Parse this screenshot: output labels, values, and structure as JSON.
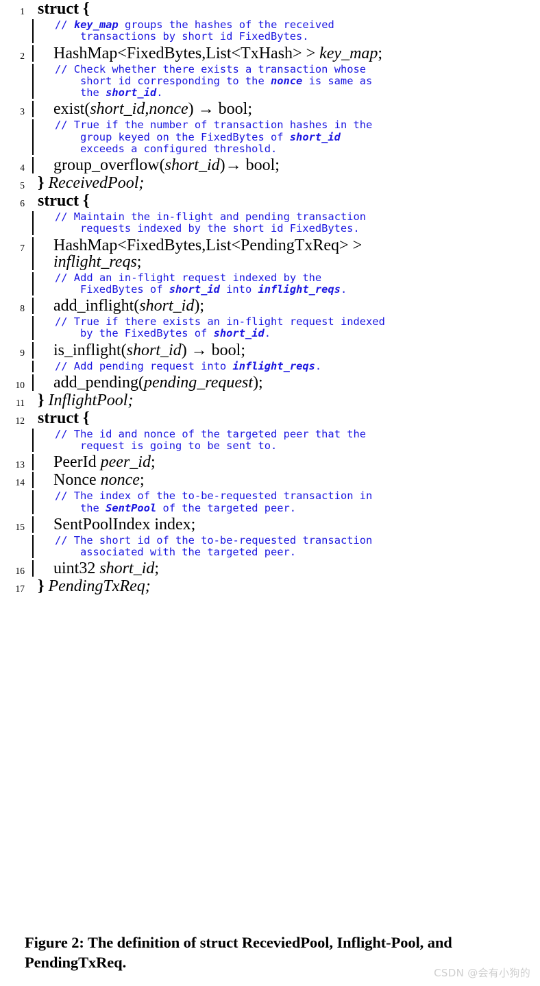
{
  "figure": {
    "caption": "Figure 2: The definition of struct ReceviedPool, Inflight-Pool, and PendingTxReq."
  },
  "watermark": {
    "text": "CSDN @会有小狗的"
  },
  "colors": {
    "comment_blue": "#1a16e0",
    "code_black": "#000000",
    "page_background": "#ffffff",
    "watermark_gray": "#cfcfcf"
  },
  "listing": {
    "lines": [
      {
        "number": "1",
        "kind": "struct-open",
        "text": "struct {"
      },
      {
        "number": "",
        "kind": "comment",
        "segments": [
          {
            "text": "// ",
            "style": "plain"
          },
          {
            "text": "key_map",
            "style": "italic"
          },
          {
            "text": " groups the hashes of the received",
            "style": "plain"
          }
        ],
        "continuation": [
          {
            "text": "transactions by short id FixedBytes.",
            "style": "plain"
          }
        ]
      },
      {
        "number": "2",
        "kind": "code",
        "segments": [
          {
            "text": "HashMap<FixedBytes,List<TxHash> > ",
            "style": "plain"
          },
          {
            "text": "key_map",
            "style": "italic"
          },
          {
            "text": ";",
            "style": "plain"
          }
        ]
      },
      {
        "number": "",
        "kind": "comment",
        "segments": [
          {
            "text": "// Check whether there exists a transaction whose",
            "style": "plain"
          }
        ],
        "continuation": [
          {
            "text": "short id corresponding to the ",
            "style": "plain"
          },
          {
            "text": "nonce",
            "style": "italic"
          },
          {
            "text": " is same as",
            "style": "plain"
          }
        ],
        "continuation2": [
          {
            "text": "the ",
            "style": "plain"
          },
          {
            "text": "short_id",
            "style": "italic"
          },
          {
            "text": ".",
            "style": "plain"
          }
        ]
      },
      {
        "number": "3",
        "kind": "code",
        "segments": [
          {
            "text": "exist(",
            "style": "plain"
          },
          {
            "text": "short_id,nonce",
            "style": "italic"
          },
          {
            "text": ") → bool;",
            "style": "plain"
          }
        ]
      },
      {
        "number": "",
        "kind": "comment",
        "segments": [
          {
            "text": "// True if the number of transaction hashes in the",
            "style": "plain"
          }
        ],
        "continuation": [
          {
            "text": "group keyed on the FixedBytes of ",
            "style": "plain"
          },
          {
            "text": "short_id",
            "style": "italic"
          }
        ],
        "continuation2": [
          {
            "text": "exceeds a configured threshold.",
            "style": "plain"
          }
        ]
      },
      {
        "number": "4",
        "kind": "code",
        "segments": [
          {
            "text": "group_overflow(",
            "style": "plain"
          },
          {
            "text": "short_id",
            "style": "italic"
          },
          {
            "text": ")→ bool;",
            "style": "plain"
          }
        ]
      },
      {
        "number": "5",
        "kind": "struct-close",
        "segments": [
          {
            "text": "}",
            "style": "bold"
          },
          {
            "text": " ReceivedPool;",
            "style": "italic"
          }
        ]
      },
      {
        "number": "6",
        "kind": "struct-open",
        "text": "struct {"
      },
      {
        "number": "",
        "kind": "comment",
        "segments": [
          {
            "text": "// Maintain the in-flight and pending transaction",
            "style": "plain"
          }
        ],
        "continuation": [
          {
            "text": "requests indexed by the short id FixedBytes.",
            "style": "plain"
          }
        ]
      },
      {
        "number": "7",
        "kind": "code-wrap",
        "segments": [
          {
            "text": "HashMap<FixedBytes,List<PendingTxReq> >",
            "style": "plain"
          }
        ],
        "wrapped": [
          {
            "text": "inflight_reqs",
            "style": "italic"
          },
          {
            "text": ";",
            "style": "plain"
          }
        ]
      },
      {
        "number": "",
        "kind": "comment",
        "segments": [
          {
            "text": "// Add an in-flight request indexed by the",
            "style": "plain"
          }
        ],
        "continuation": [
          {
            "text": "FixedBytes of ",
            "style": "plain"
          },
          {
            "text": "short_id",
            "style": "italic"
          },
          {
            "text": " into ",
            "style": "plain"
          },
          {
            "text": "inflight_reqs",
            "style": "italic"
          },
          {
            "text": ".",
            "style": "plain"
          }
        ]
      },
      {
        "number": "8",
        "kind": "code",
        "segments": [
          {
            "text": "add_inflight(",
            "style": "plain"
          },
          {
            "text": "short_id",
            "style": "italic"
          },
          {
            "text": ");",
            "style": "plain"
          }
        ]
      },
      {
        "number": "",
        "kind": "comment",
        "segments": [
          {
            "text": "// True if there exists an in-flight request indexed",
            "style": "plain"
          }
        ],
        "continuation": [
          {
            "text": "by the FixedBytes of ",
            "style": "plain"
          },
          {
            "text": "short_id",
            "style": "italic"
          },
          {
            "text": ".",
            "style": "plain"
          }
        ]
      },
      {
        "number": "9",
        "kind": "code",
        "segments": [
          {
            "text": "is_inflight(",
            "style": "plain"
          },
          {
            "text": "short_id",
            "style": "italic"
          },
          {
            "text": ") → bool;",
            "style": "plain"
          }
        ]
      },
      {
        "number": "",
        "kind": "comment",
        "segments": [
          {
            "text": "// Add pending request into ",
            "style": "plain"
          },
          {
            "text": "inflight_reqs",
            "style": "italic"
          },
          {
            "text": ".",
            "style": "plain"
          }
        ]
      },
      {
        "number": "10",
        "kind": "code",
        "segments": [
          {
            "text": "add_pending(",
            "style": "plain"
          },
          {
            "text": "pending_request",
            "style": "italic"
          },
          {
            "text": ");",
            "style": "plain"
          }
        ]
      },
      {
        "number": "11",
        "kind": "struct-close",
        "segments": [
          {
            "text": "}",
            "style": "bold"
          },
          {
            "text": " InflightPool;",
            "style": "italic"
          }
        ]
      },
      {
        "number": "12",
        "kind": "struct-open",
        "text": "struct {"
      },
      {
        "number": "",
        "kind": "comment",
        "segments": [
          {
            "text": "// The id and nonce of the targeted peer that the",
            "style": "plain"
          }
        ],
        "continuation": [
          {
            "text": "request is going to be sent to.",
            "style": "plain"
          }
        ]
      },
      {
        "number": "13",
        "kind": "code",
        "segments": [
          {
            "text": "PeerId ",
            "style": "plain"
          },
          {
            "text": "peer_id",
            "style": "italic"
          },
          {
            "text": ";",
            "style": "plain"
          }
        ]
      },
      {
        "number": "14",
        "kind": "code",
        "segments": [
          {
            "text": "Nonce ",
            "style": "plain"
          },
          {
            "text": "nonce",
            "style": "italic"
          },
          {
            "text": ";",
            "style": "plain"
          }
        ]
      },
      {
        "number": "",
        "kind": "comment",
        "segments": [
          {
            "text": "// The index of the to-be-requested transaction in",
            "style": "plain"
          }
        ],
        "continuation": [
          {
            "text": "the ",
            "style": "plain"
          },
          {
            "text": "SentPool",
            "style": "italic"
          },
          {
            "text": " of the targeted peer.",
            "style": "plain"
          }
        ]
      },
      {
        "number": "15",
        "kind": "code",
        "segments": [
          {
            "text": "SentPoolIndex index;",
            "style": "plain"
          }
        ]
      },
      {
        "number": "",
        "kind": "comment",
        "segments": [
          {
            "text": "// The short id of the to-be-requested transaction",
            "style": "plain"
          }
        ],
        "continuation": [
          {
            "text": "associated with the targeted peer.",
            "style": "plain"
          }
        ]
      },
      {
        "number": "16",
        "kind": "code",
        "segments": [
          {
            "text": "uint32 ",
            "style": "plain"
          },
          {
            "text": "short_id",
            "style": "italic"
          },
          {
            "text": ";",
            "style": "plain"
          }
        ]
      },
      {
        "number": "17",
        "kind": "struct-close",
        "segments": [
          {
            "text": "}",
            "style": "bold"
          },
          {
            "text": " PendingTxReq;",
            "style": "italic"
          }
        ]
      }
    ]
  }
}
